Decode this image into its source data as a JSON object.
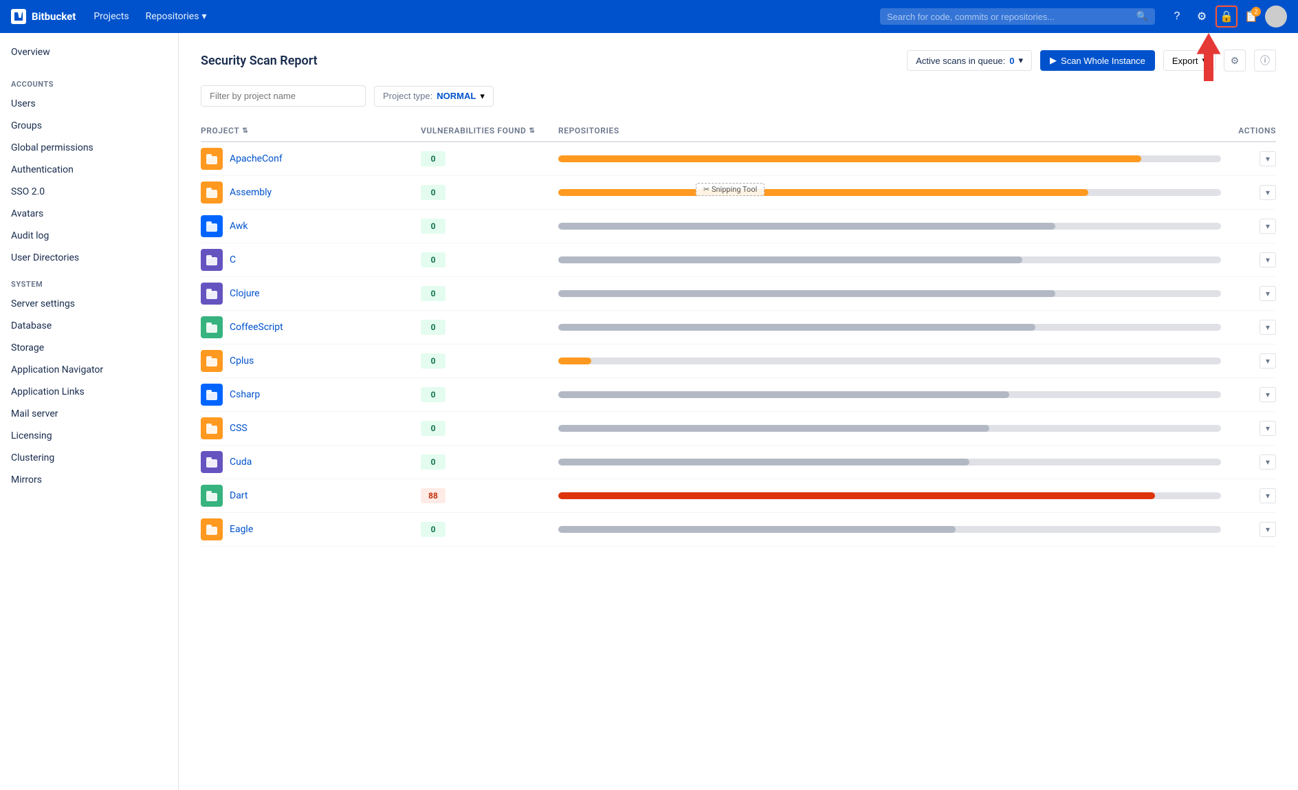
{
  "topnav": {
    "logo_text": "Bitbucket",
    "nav_items": [
      "Projects",
      "Repositories"
    ],
    "search_placeholder": "Search for code, commits or repositories...",
    "icons": [
      "question-icon",
      "gear-icon",
      "lock-icon",
      "notification-icon"
    ],
    "notification_count": "2"
  },
  "sidebar": {
    "overview_label": "Overview",
    "sections": [
      {
        "header": "ACCOUNTS",
        "items": [
          "Users",
          "Groups",
          "Global permissions",
          "Authentication",
          "SSO 2.0",
          "Avatars",
          "Audit log",
          "User Directories"
        ]
      },
      {
        "header": "SYSTEM",
        "items": [
          "Server settings",
          "Database",
          "Storage",
          "Application Navigator",
          "Application Links",
          "Mail server",
          "Licensing",
          "Clustering",
          "Mirrors"
        ]
      }
    ]
  },
  "report": {
    "title": "Security Scan Report",
    "active_scans_label": "Active scans in queue:",
    "active_scans_count": "0",
    "scan_btn_label": "Scan Whole Instance",
    "export_btn_label": "Export",
    "filter_placeholder": "Filter by project name",
    "project_type_label": "Project type:",
    "project_type_value": "NORMAL",
    "columns": [
      "Project",
      "Vulnerabilities Found",
      "Repositories",
      "Actions"
    ],
    "rows": [
      {
        "name": "ApacheConf",
        "icon_color": "#ff991f",
        "icon_bg": "#ff991f",
        "vuln": "0",
        "vuln_type": "zero",
        "bar_pct": 88,
        "bar_color": "orange"
      },
      {
        "name": "Assembly",
        "icon_color": "#ff991f",
        "icon_bg": "#ff991f",
        "vuln": "0",
        "vuln_type": "zero",
        "bar_pct": 80,
        "bar_color": "orange"
      },
      {
        "name": "Awk",
        "icon_color": "#0052cc",
        "icon_bg": "#0065ff",
        "vuln": "0",
        "vuln_type": "zero",
        "bar_pct": 75,
        "bar_color": "gray"
      },
      {
        "name": "C",
        "icon_color": "#6554c0",
        "icon_bg": "#6554c0",
        "vuln": "0",
        "vuln_type": "zero",
        "bar_pct": 70,
        "bar_color": "gray"
      },
      {
        "name": "Clojure",
        "icon_color": "#6554c0",
        "icon_bg": "#6554c0",
        "vuln": "0",
        "vuln_type": "zero",
        "bar_pct": 75,
        "bar_color": "gray"
      },
      {
        "name": "CoffeeScript",
        "icon_color": "#36b37e",
        "icon_bg": "#36b37e",
        "vuln": "0",
        "vuln_type": "zero",
        "bar_pct": 72,
        "bar_color": "gray"
      },
      {
        "name": "Cplus",
        "icon_color": "#ff991f",
        "icon_bg": "#ff991f",
        "vuln": "0",
        "vuln_type": "zero",
        "bar_pct": 5,
        "bar_color": "short-orange"
      },
      {
        "name": "Csharp",
        "icon_color": "#0052cc",
        "icon_bg": "#0065ff",
        "vuln": "0",
        "vuln_type": "zero",
        "bar_pct": 68,
        "bar_color": "gray"
      },
      {
        "name": "CSS",
        "icon_color": "#ff991f",
        "icon_bg": "#ff991f",
        "vuln": "0",
        "vuln_type": "zero",
        "bar_pct": 65,
        "bar_color": "gray"
      },
      {
        "name": "Cuda",
        "icon_color": "#6554c0",
        "icon_bg": "#6554c0",
        "vuln": "0",
        "vuln_type": "zero",
        "bar_pct": 62,
        "bar_color": "gray"
      },
      {
        "name": "Dart",
        "icon_color": "#36b37e",
        "icon_bg": "#36b37e",
        "vuln": "88",
        "vuln_type": "high",
        "bar_pct": 90,
        "bar_color": "red"
      },
      {
        "name": "Eagle",
        "icon_color": "#ff991f",
        "icon_bg": "#ff991f",
        "vuln": "0",
        "vuln_type": "zero",
        "bar_pct": 60,
        "bar_color": "gray"
      }
    ]
  }
}
